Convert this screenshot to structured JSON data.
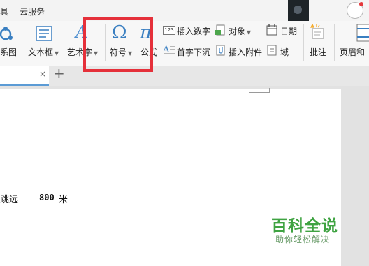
{
  "menubar": {
    "items": [
      "具",
      "云服务"
    ]
  },
  "ribbon": {
    "left_partial_label": "系图",
    "textbox_label": "文本框",
    "wordart_label": "艺术字",
    "symbol_label": "符号",
    "formula_label": "公式",
    "insert_number_label": "插入数字",
    "object_label": "对象",
    "date_label": "日期",
    "drop_cap_label": "首字下沉",
    "insert_attachment_label": "插入附件",
    "field_label": "域",
    "comment_label": "批注",
    "header_footer_label": "页眉和",
    "number_icon_text": "123"
  },
  "tabs": {
    "close_glyph": "×",
    "add_glyph": "+"
  },
  "document": {
    "label": "跳远",
    "value": "800",
    "unit": "米"
  },
  "watermark": {
    "title": "百科全说",
    "subtitle": "助你轻松解决"
  },
  "colors": {
    "highlight": "#e5303a",
    "accent_blue": "#3a7fc1",
    "watermark_green": "#3fa342"
  }
}
